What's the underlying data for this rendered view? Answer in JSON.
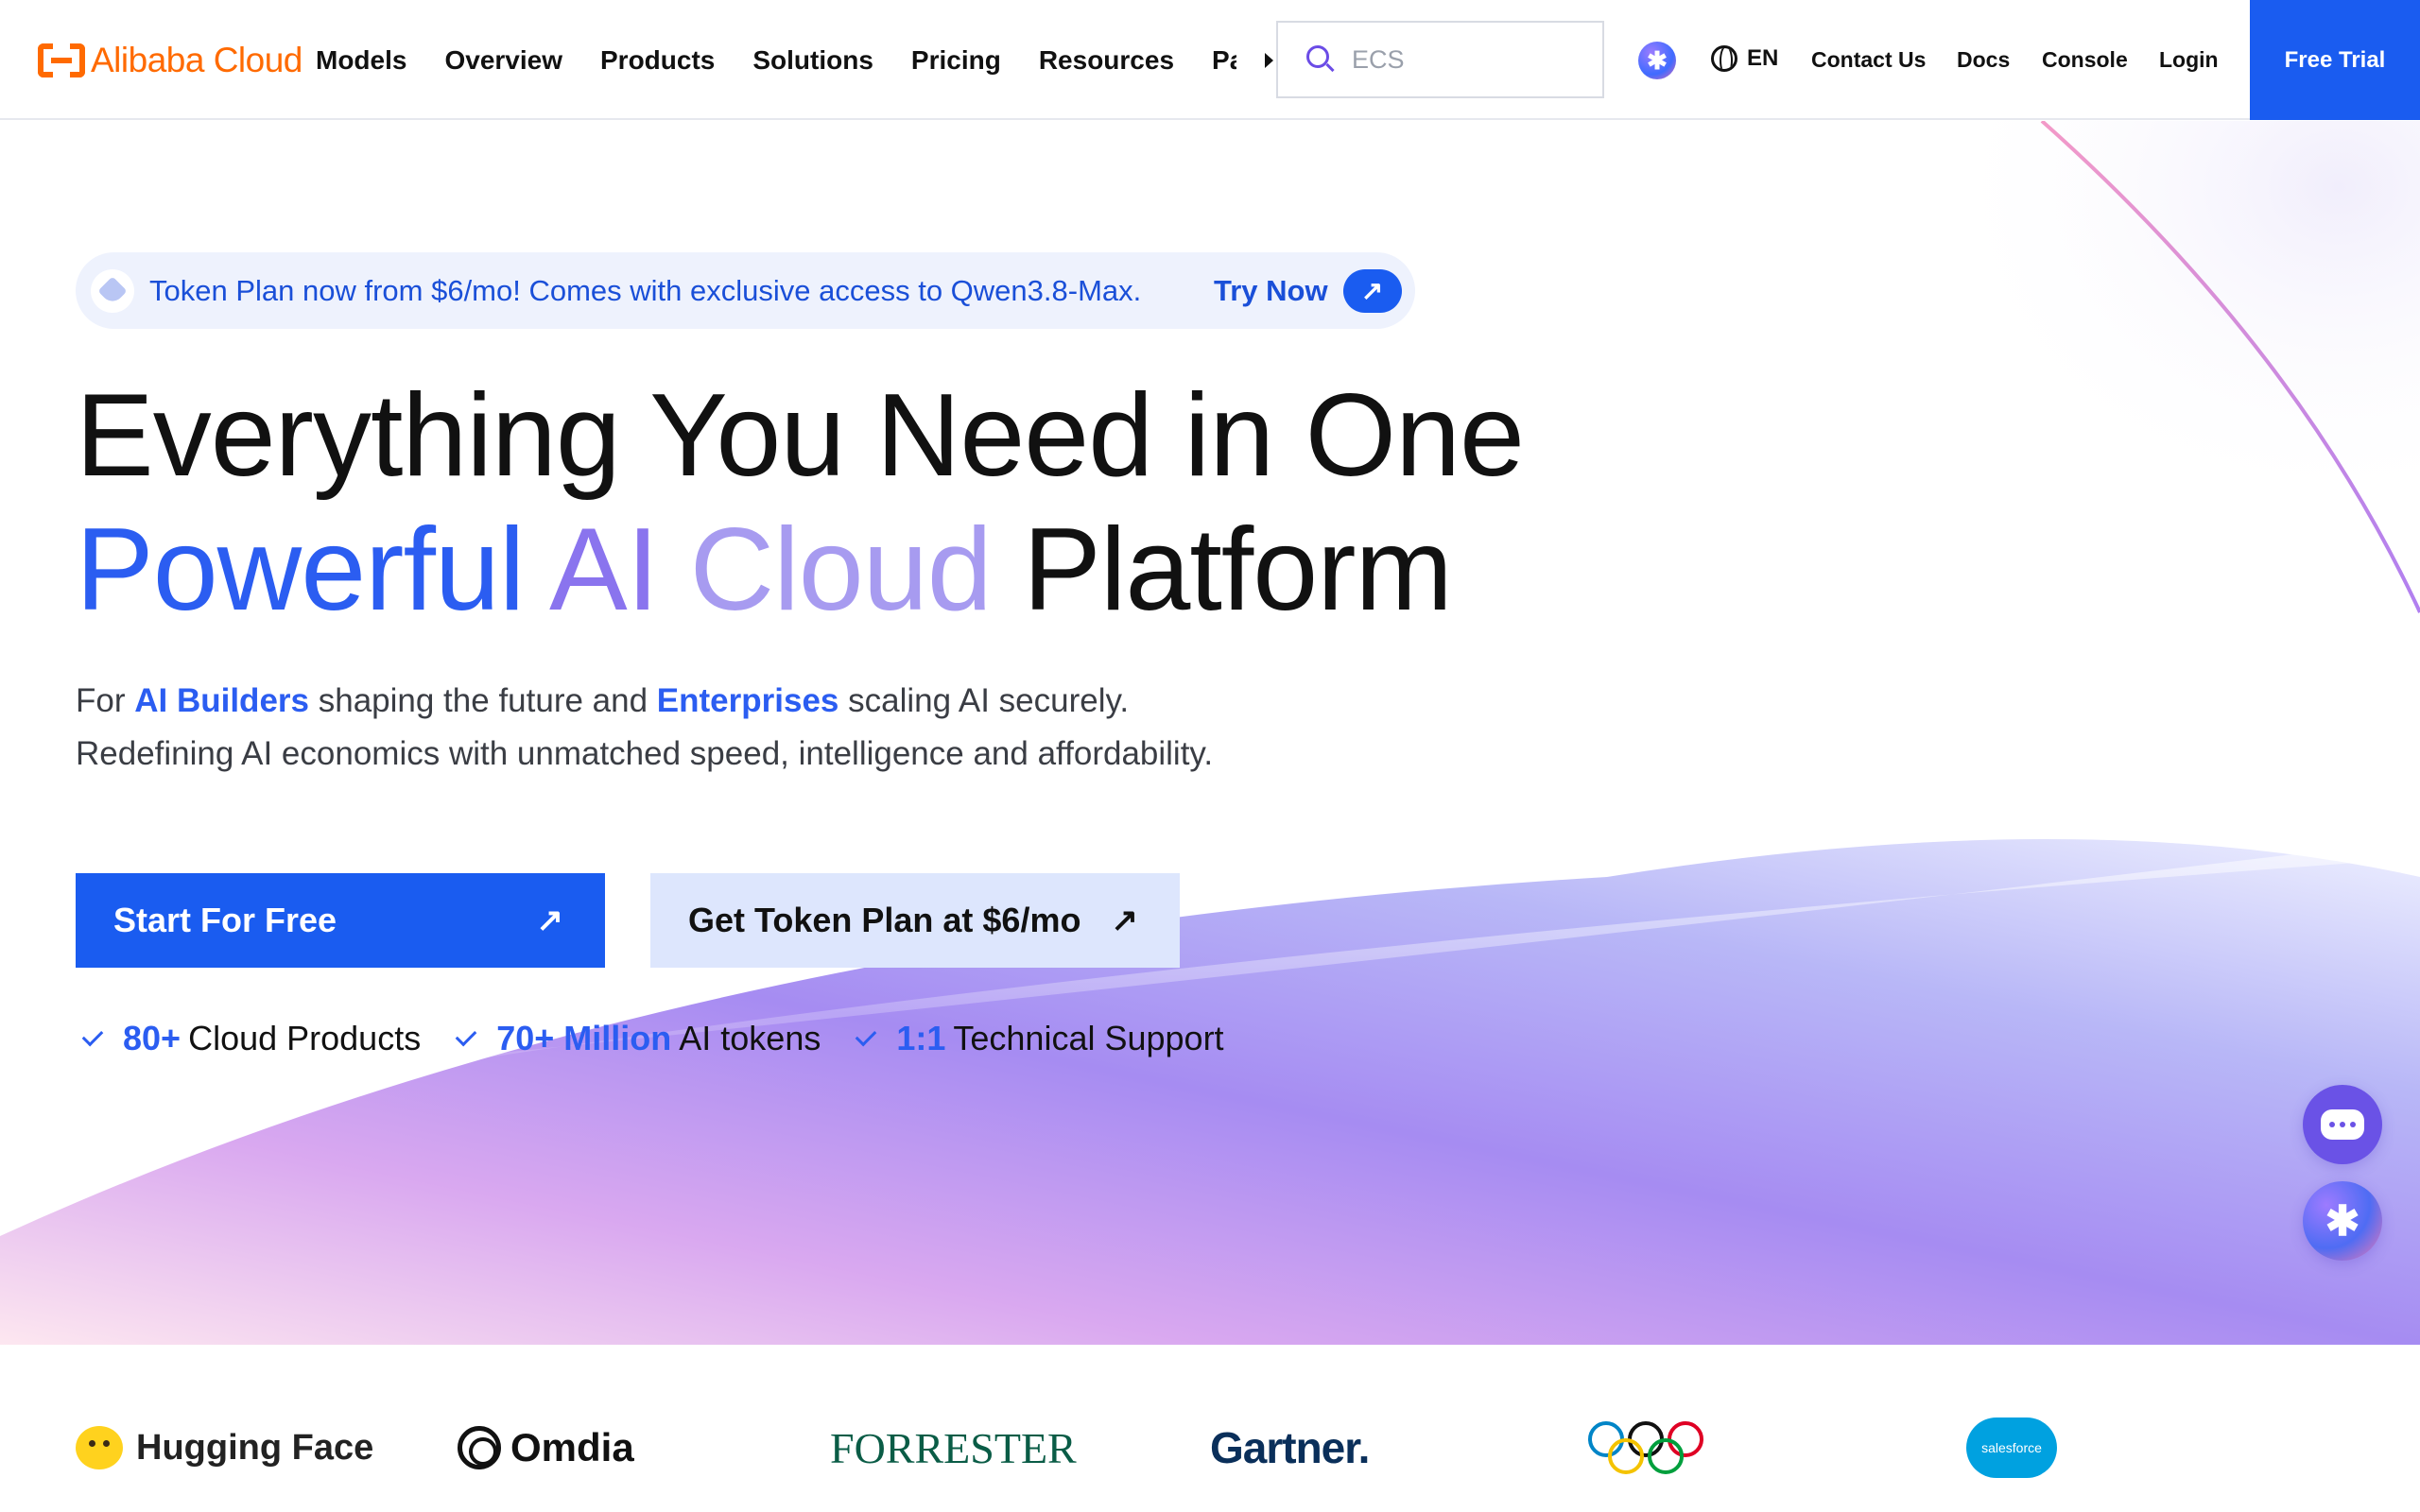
{
  "header": {
    "logo_text": "Alibaba Cloud",
    "nav": [
      "Models",
      "Overview",
      "Products",
      "Solutions",
      "Pricing",
      "Resources",
      "Pa"
    ],
    "search_placeholder": "ECS",
    "lang": "EN",
    "links": [
      "Contact Us",
      "Docs",
      "Console",
      "Login"
    ],
    "free_trial": "Free Trial"
  },
  "promo": {
    "text": "Token Plan now from $6/mo! Comes with exclusive access to Qwen3.8-Max.",
    "cta": "Try Now",
    "cta_icon": "arrow-up-right-icon"
  },
  "hero": {
    "headline_line1": "Everything You Need in One",
    "headline_w1": "Powerful",
    "headline_w2": "AI",
    "headline_w3": "Cloud",
    "headline_w4": "Platform",
    "sub_for": "For",
    "sub_em1": "AI Builders",
    "sub_mid": "shaping the future and",
    "sub_em2": "Enterprises",
    "sub_end": "scaling AI securely.",
    "sub_line2": "Redefining AI economics with unmatched speed, intelligence and affordability.",
    "btn_primary": "Start For Free",
    "btn_secondary": "Get Token Plan at $6/mo",
    "stats": [
      {
        "num": "80+",
        "label": "Cloud Products"
      },
      {
        "num": "70+ Million",
        "label": "AI tokens"
      },
      {
        "num": "1:1",
        "label": "Technical Support"
      }
    ]
  },
  "partners": {
    "huggingface": "Hugging Face",
    "omdia": "Omdia",
    "forrester": "FORRESTER",
    "gartner": "Gartner.",
    "salesforce": "salesforce"
  },
  "colors": {
    "brand_orange": "#ff6a00",
    "primary_blue": "#1a5cf0",
    "accent_purple": "#8a74ee"
  }
}
